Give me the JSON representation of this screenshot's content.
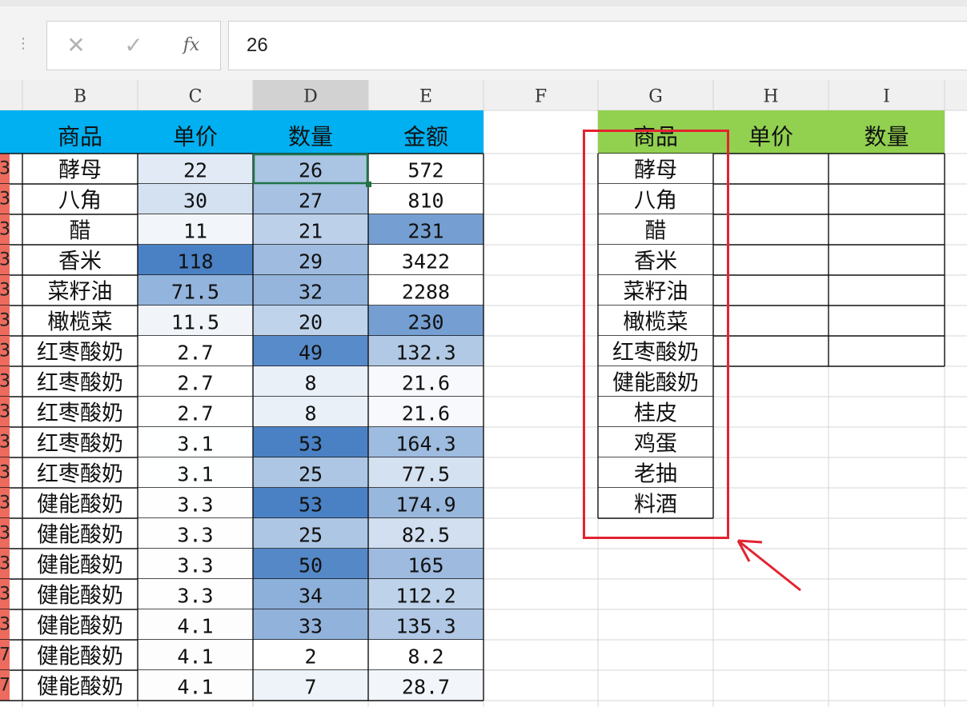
{
  "formula_bar": {
    "cancel_glyph": "✕",
    "confirm_glyph": "✓",
    "fx_label": "fx",
    "value": "26",
    "more_icon": "vertical-dots-icon"
  },
  "columns": [
    "B",
    "C",
    "D",
    "E",
    "F",
    "G",
    "H",
    "I"
  ],
  "selected_column": "D",
  "left_table": {
    "headers": [
      "商品",
      "单价",
      "数量",
      "金额"
    ],
    "header_color": "#00b0f0",
    "rows": [
      [
        "3",
        "酵母",
        "22",
        "26",
        "572"
      ],
      [
        "3",
        "八角",
        "30",
        "27",
        "810"
      ],
      [
        "3",
        "醋",
        "11",
        "21",
        "231"
      ],
      [
        "3",
        "香米",
        "118",
        "29",
        "3422"
      ],
      [
        "3",
        "菜籽油",
        "71.5",
        "32",
        "2288"
      ],
      [
        "3",
        "橄榄菜",
        "11.5",
        "20",
        "230"
      ],
      [
        "3",
        "红枣酸奶",
        "2.7",
        "49",
        "132.3"
      ],
      [
        "3",
        "红枣酸奶",
        "2.7",
        "8",
        "21.6"
      ],
      [
        "3",
        "红枣酸奶",
        "2.7",
        "8",
        "21.6"
      ],
      [
        "3",
        "红枣酸奶",
        "3.1",
        "53",
        "164.3"
      ],
      [
        "3",
        "红枣酸奶",
        "3.1",
        "25",
        "77.5"
      ],
      [
        "3",
        "健能酸奶",
        "3.3",
        "53",
        "174.9"
      ],
      [
        "3",
        "健能酸奶",
        "3.3",
        "25",
        "82.5"
      ],
      [
        "3",
        "健能酸奶",
        "3.3",
        "50",
        "165"
      ],
      [
        "3",
        "健能酸奶",
        "3.3",
        "34",
        "112.2"
      ],
      [
        "3",
        "健能酸奶",
        "4.1",
        "33",
        "135.3"
      ],
      [
        "7",
        "健能酸奶",
        "4.1",
        "2",
        "8.2"
      ],
      [
        "7",
        "健能酸奶",
        "4.1",
        "7",
        "28.7"
      ]
    ]
  },
  "right_table": {
    "headers": [
      "商品",
      "单价",
      "数量"
    ],
    "header_color": "#92d050",
    "items": [
      "酵母",
      "八角",
      "醋",
      "香米",
      "菜籽油",
      "橄榄菜",
      "红枣酸奶",
      "健能酸奶",
      "桂皮",
      "鸡蛋",
      "老抽",
      "料酒"
    ]
  },
  "colors": {
    "scale_light": "#ffffff",
    "scale_dark": "#4a81c4",
    "selection": "#217346",
    "annotation": "#e3232f",
    "row_number_tab": "#ec6b5e"
  }
}
